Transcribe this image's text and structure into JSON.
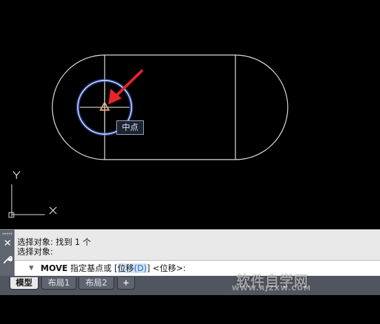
{
  "canvas": {
    "background": "#000000",
    "osnap_tooltip": "中点",
    "ucs": {
      "x_label": "X",
      "y_label": "Y"
    }
  },
  "command_line": {
    "history": [
      "选择对象: 找到 1 个",
      "选择对象:"
    ],
    "prompt_command": "MOVE",
    "prompt_text": "指定基点或 [",
    "option_label": "位移",
    "option_key": "(D)",
    "prompt_suffix": "] <位移>:"
  },
  "tabs": [
    {
      "label": "模型",
      "active": true
    },
    {
      "label": "布局1",
      "active": false
    },
    {
      "label": "布局2",
      "active": false
    },
    {
      "label": "+",
      "active": false
    }
  ],
  "watermark": {
    "main": "软件自学网",
    "url": "WWW.RJZXW.COM"
  },
  "colors": {
    "geometry": "#e6e6e6",
    "highlight": "#3c64e6",
    "snap_marker": "#f0b080",
    "arrow": "#e8232a"
  },
  "icons": [
    "close-icon",
    "wrench-icon",
    "command-arrow-icon",
    "ucs-icon",
    "midpoint-snap-icon"
  ]
}
